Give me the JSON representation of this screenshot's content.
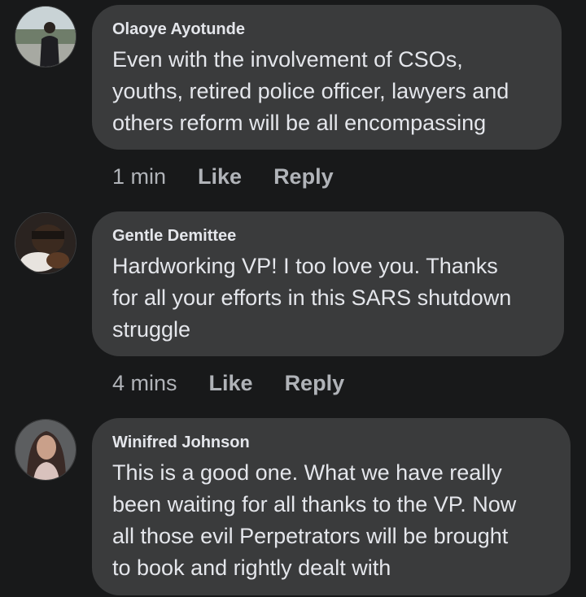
{
  "comments": [
    {
      "author": "Olaoye Ayotunde",
      "lines": [
        "Even with the involvement of CSOs,",
        "youths, retired police officer, lawyers and",
        "others reform will be all encompassing"
      ],
      "time": "1 min",
      "like_label": "Like",
      "reply_label": "Reply"
    },
    {
      "author": "Gentle Demittee",
      "lines": [
        "Hardworking VP! I too love you. Thanks",
        "for all your efforts in this SARS shutdown",
        "struggle"
      ],
      "time": "4 mins",
      "like_label": "Like",
      "reply_label": "Reply"
    },
    {
      "author": "Winifred Johnson",
      "lines": [
        "This is a good one. What we have really",
        "been waiting for all thanks to the VP. Now",
        "all those evil Perpetrators will be brought",
        "to book and rightly dealt with"
      ]
    }
  ],
  "colors": {
    "background": "#18191a",
    "bubble": "#3a3b3c",
    "primary_text": "#e4e6eb",
    "secondary_text": "#b0b3b8"
  }
}
